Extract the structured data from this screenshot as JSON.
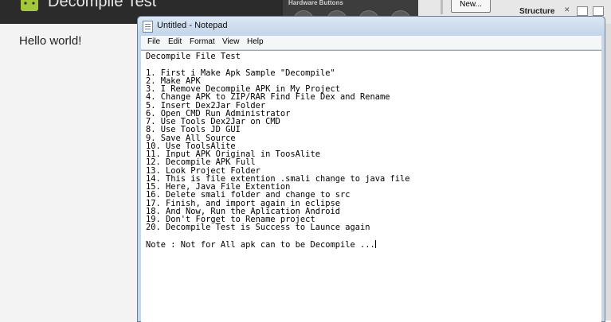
{
  "emulator": {
    "title": "Decompile Test",
    "hardware_label": "Hardware Buttons",
    "hello_text": "Hello world!"
  },
  "ide": {
    "new_button": "New...",
    "structure_label": "Structure",
    "close_glyph": "✕"
  },
  "notepad": {
    "title": "Untitled - Notepad",
    "menu": [
      "File",
      "Edit",
      "Format",
      "View",
      "Help"
    ],
    "text": "Decompile File Test\n\n1. First i Make Apk Sample \"Decompile\"\n2. Make APK\n3. I Remove Decompile APK in My Project\n4. Change APK to ZIP/RAR Find File Dex and Rename\n5. Insert Dex2Jar Folder\n6. Open CMD Run Administrator\n7. Use Tools Dex2Jar on CMD\n8. Use Tools JD GUI\n9. Save All Source\n10. Use ToolsAlite\n11. Input APK Original in ToosAlite\n12. Decompile APK Full\n13. Look Project Folder\n14. This is file extention .smali change to java file\n15. Here, Java File Extention\n16. Delete smali folder and change to src\n17. Finish, and import again in eclipse\n18. And Now, Run the Aplication Android\n19. Don't Forget to Rename project\n20. Decompile Test is Success to Launce again\n\nNote : Not for All apk can to be Decompile ..."
  }
}
